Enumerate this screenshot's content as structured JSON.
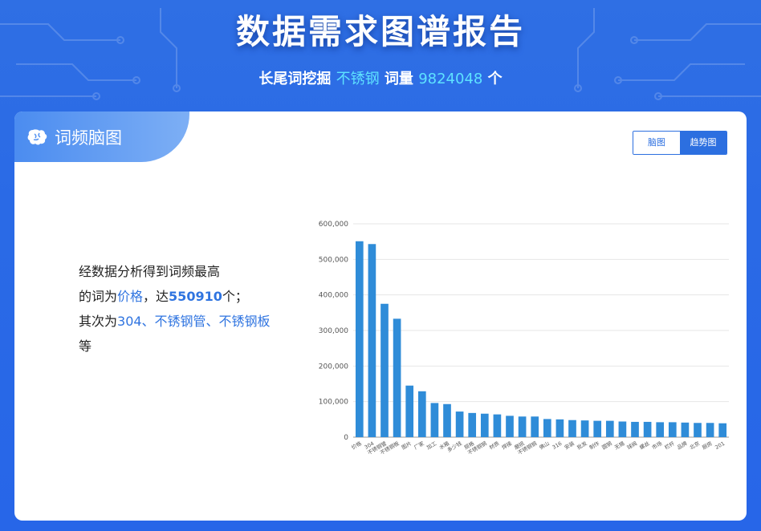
{
  "header": {
    "title": "数据需求图谱报告",
    "sub_prefix": "长尾词挖掘",
    "keyword": "不锈钢",
    "sub_mid": "词量",
    "volume": "9824048",
    "sub_suffix": "个"
  },
  "card": {
    "tab_label": "词频脑图",
    "toggle": [
      "脑图",
      "趋势图"
    ],
    "active_toggle": "趋势图"
  },
  "summary": {
    "line1": "经数据分析得到词频最高",
    "line2_prefix": "的词为",
    "top_word": "价格",
    "line2_mid": "，达",
    "top_count": "550910",
    "line2_suffix": "个；",
    "line3_prefix": "其次为",
    "next_words": "304、不锈钢管、不锈钢板",
    "line4": "等"
  },
  "colors": {
    "bar": "#2f8cd8",
    "accent": "#2c6fe0",
    "highlight": "#5ee2ff"
  },
  "chart_data": {
    "type": "bar",
    "categories": [
      "价格",
      "304",
      "不锈钢管",
      "不锈钢板",
      "图片",
      "厂家",
      "加工",
      "水箱",
      "多少钱",
      "规格",
      "不锈钢钢",
      "材质",
      "焊接",
      "磨损",
      "不锈钢钢",
      "佛山",
      "316",
      "安装",
      "批发",
      "制作",
      "圆钢",
      "无锡",
      "球阀",
      "螺丝",
      "市场",
      "栏杆",
      "品牌",
      "北京",
      "厨房",
      "201"
    ],
    "values": [
      550910,
      543000,
      375000,
      333000,
      145000,
      129000,
      96000,
      93000,
      72000,
      68000,
      66000,
      64000,
      60000,
      58000,
      58000,
      51000,
      50000,
      48000,
      47000,
      46000,
      46000,
      44000,
      43000,
      43000,
      42000,
      42000,
      41000,
      40000,
      40000,
      39000
    ],
    "ylim": [
      0,
      600000
    ],
    "yticks": [
      "0",
      "100,000",
      "200,000",
      "300,000",
      "400,000",
      "500,000",
      "600,000"
    ],
    "grid": true
  }
}
